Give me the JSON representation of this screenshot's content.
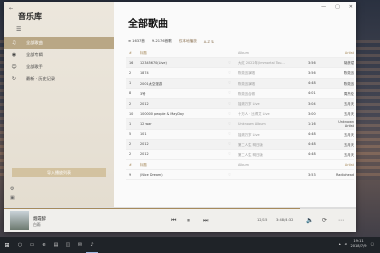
{
  "sidebar": {
    "back_icon": "back-arrow-icon",
    "title": "音乐库",
    "menu_icon": "hamburger-icon",
    "nav": [
      {
        "label": "全部歌曲",
        "icon": "music-note-icon",
        "active": true
      },
      {
        "label": "全部专辑",
        "icon": "album-icon",
        "active": false
      },
      {
        "label": "全部歌手",
        "icon": "artist-icon",
        "active": false
      },
      {
        "label": "最新 · 历史记录",
        "icon": "history-icon",
        "active": false
      }
    ],
    "import_label": "导入播放列表"
  },
  "main": {
    "title": "全部歌曲",
    "toolbar": {
      "sort_label": "≡ 1637首",
      "col_a": "9-2176首歌",
      "col_b": "仅本地播放",
      "col_c": "A-Z ⇅"
    },
    "header": {
      "num": "#",
      "title": "标题",
      "album": "Album",
      "artist": "Artist"
    },
    "rows": [
      {
        "num": "16",
        "title": "12345670(Live)",
        "album": "大红 2022年(Immortal Tou...",
        "dur": "3:56",
        "artist": "胡彦斌"
      },
      {
        "num": "2",
        "title": "1874",
        "album": "陈奕迅演唱",
        "dur": "3:56",
        "artist": "陈奕迅"
      },
      {
        "num": "1",
        "title": "2001太空漫游",
        "album": "陈奕迅演唱",
        "dur": "4:48",
        "artist": "陈奕迅"
      },
      {
        "num": "8",
        "title": "3号",
        "album": "陈奕迅合辑",
        "dur": "4:01",
        "artist": "周杰伦"
      },
      {
        "num": "2",
        "title": "2012",
        "album": "摇滚万岁 Live",
        "dur": "3:04",
        "artist": "五月天"
      },
      {
        "num": "10",
        "title": "100000 people & MayDay",
        "album": "十万人 · 比得艾 Live",
        "dur": "3:00",
        "artist": "五月天"
      },
      {
        "num": "1",
        "title": "12 war",
        "album": "Unknown Album",
        "dur": "1:16",
        "artist": "Unknown Artist"
      },
      {
        "num": "5",
        "title": "101",
        "album": "摇滚万岁 Live",
        "dur": "4:48",
        "artist": "五月天"
      },
      {
        "num": "2",
        "title": "2012",
        "album": "第二人生 明日版",
        "dur": "4:48",
        "artist": "五月天"
      },
      {
        "num": "2",
        "title": "2012",
        "album": "第二人生 明日版",
        "dur": "4:48",
        "artist": "五月天"
      }
    ],
    "footer": {
      "num": "#",
      "title": "标题",
      "album": "Album",
      "artist": "Artist"
    },
    "last_row": {
      "num": "9",
      "title": "(Nice Dream)",
      "album": "",
      "dur": "3:53",
      "artist": "Radiohead"
    }
  },
  "player": {
    "title": "烟霞醉",
    "artist": "白雨",
    "track_pos": "12/15",
    "time": "3:48/4:32",
    "progress": 0.84
  },
  "taskbar": {
    "time": "19:11",
    "date": "2018/7/9"
  }
}
